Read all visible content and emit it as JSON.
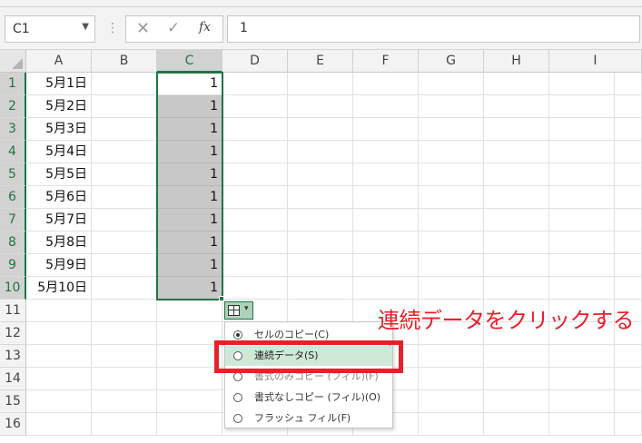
{
  "formula_bar": {
    "name_box": "C1",
    "separator": "⋮",
    "cancel_icon": "close-icon",
    "enter_icon": "check-icon",
    "function_label": "fx",
    "formula_value": "1"
  },
  "columns": [
    "A",
    "B",
    "C",
    "D",
    "E",
    "F",
    "G",
    "H",
    "I"
  ],
  "selected_column": "C",
  "rows": [
    "1",
    "2",
    "3",
    "4",
    "5",
    "6",
    "7",
    "8",
    "9",
    "10",
    "11",
    "12",
    "13",
    "14",
    "15",
    "16"
  ],
  "cells": {
    "column_a": [
      "5月1日",
      "5月2日",
      "5月3日",
      "5月4日",
      "5月5日",
      "5月6日",
      "5月7日",
      "5月8日",
      "5月9日",
      "5月10日"
    ],
    "column_c": [
      "1",
      "1",
      "1",
      "1",
      "1",
      "1",
      "1",
      "1",
      "1",
      "1"
    ]
  },
  "autofill": {
    "button_icon": "autofill-options-icon",
    "button_caret": "▾",
    "options": [
      {
        "label": "セルのコピー(C)",
        "checked": true
      },
      {
        "label": "連続データ(S)",
        "checked": false
      },
      {
        "label": "書式のみコピー (フィル)(F)",
        "checked": false
      },
      {
        "label": "書式なしコピー (フィル)(O)",
        "checked": false
      },
      {
        "label": "フラッシュ フィル(F)",
        "checked": false
      }
    ]
  },
  "annotation": {
    "text": "連続データをクリックする",
    "color": "#e8202a"
  },
  "colors": {
    "excel_green": "#217346",
    "selection_gray": "#c8c8c8",
    "menu_hover": "#cfe8d8"
  }
}
